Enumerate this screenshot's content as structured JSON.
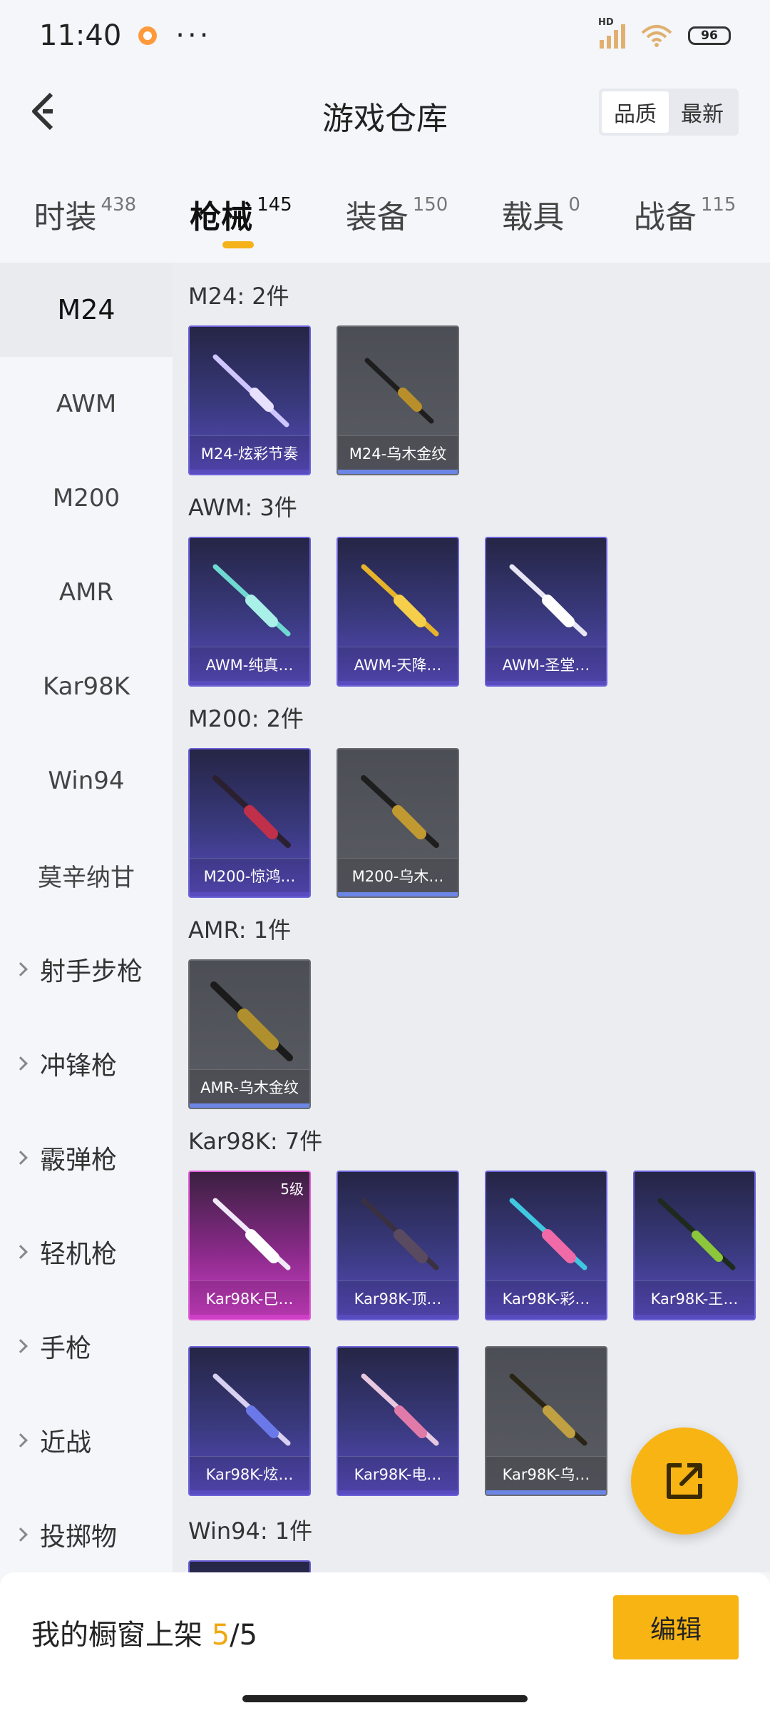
{
  "status": {
    "time": "11:40",
    "more": "···",
    "network": "HD",
    "battery": "96"
  },
  "header": {
    "title": "游戏仓库",
    "sort": [
      "品质",
      "最新"
    ]
  },
  "tabs": [
    {
      "label": "时装",
      "count": "438"
    },
    {
      "label": "枪械",
      "count": "145"
    },
    {
      "label": "装备",
      "count": "150"
    },
    {
      "label": "载具",
      "count": "0"
    },
    {
      "label": "战备",
      "count": "115"
    }
  ],
  "sidebar": {
    "items": [
      "M24",
      "AWM",
      "M200",
      "AMR",
      "Kar98K",
      "Win94",
      "莫辛纳甘"
    ],
    "groups": [
      "射手步枪",
      "冲锋枪",
      "霰弹枪",
      "轻机枪",
      "手枪",
      "近战",
      "投掷物"
    ]
  },
  "sections": [
    {
      "title": "M24: 2件",
      "cards": [
        "M24-炫彩节奏",
        "M24-乌木金纹"
      ]
    },
    {
      "title": "AWM: 3件",
      "cards": [
        "AWM-纯真…",
        "AWM-天降…",
        "AWM-圣堂…"
      ]
    },
    {
      "title": "M200: 2件",
      "cards": [
        "M200-惊鸿…",
        "M200-乌木…"
      ]
    },
    {
      "title": "AMR: 1件",
      "cards": [
        "AMR-乌木金纹"
      ]
    },
    {
      "title": "Kar98K: 7件",
      "badge": "5级",
      "cards": [
        "Kar98K-巳…",
        "Kar98K-顶…",
        "Kar98K-彩…",
        "Kar98K-王…",
        "Kar98K-炫…",
        "Kar98K-电…",
        "Kar98K-乌…"
      ]
    },
    {
      "title": "Win94: 1件",
      "cards": []
    }
  ],
  "bottom": {
    "showcase_label": "我的橱窗上架",
    "current": "5",
    "separator": "/",
    "total": "5",
    "edit": "编辑"
  },
  "colors": {
    "accent": "#f7b413",
    "card_purple": "#5a4cc0",
    "card_grey": "#5b5d64",
    "card_pink": "#d040c8"
  },
  "icons": {
    "back": "chevron-left-icon",
    "fab": "share-external-icon",
    "expand": "chevron-right-icon"
  }
}
